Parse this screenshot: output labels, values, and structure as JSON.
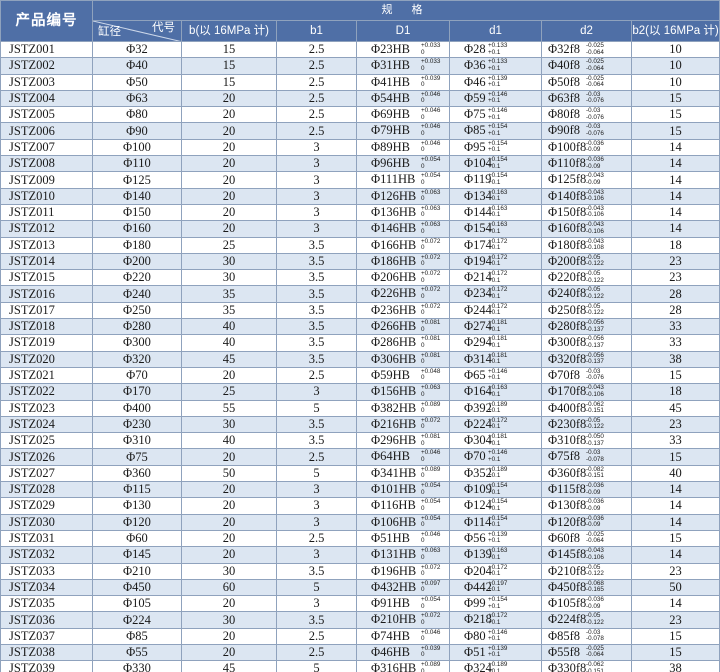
{
  "header": {
    "product_no": "产品编号",
    "specs": "规  格",
    "bore": "缸径",
    "code": "代号",
    "b": "b(以 16MPa 计)",
    "b1": "b1",
    "D1": "D1",
    "d1": "d1",
    "d2": "d2",
    "b2": "b2(以 16MPa 计)"
  },
  "rows": [
    {
      "model": "JSTZ001",
      "bore": "Φ32",
      "b": "15",
      "b1": "2.5",
      "D1": "Φ23HB",
      "D1_up": "+0.033",
      "D1_lo": "0",
      "d1": "Φ28",
      "d1_up": "+0.133",
      "d1_lo": "+0.1",
      "d2": "Φ32f8",
      "d2_up": "-0.025",
      "d2_lo": "-0.064",
      "b2": "10"
    },
    {
      "model": "JSTZ002",
      "bore": "Φ40",
      "b": "15",
      "b1": "2.5",
      "D1": "Φ31HB",
      "D1_up": "+0.033",
      "D1_lo": "0",
      "d1": "Φ36",
      "d1_up": "+0.133",
      "d1_lo": "+0.1",
      "d2": "Φ40f8",
      "d2_up": "-0.025",
      "d2_lo": "-0.064",
      "b2": "10"
    },
    {
      "model": "JSTZ003",
      "bore": "Φ50",
      "b": "15",
      "b1": "2.5",
      "D1": "Φ41HB",
      "D1_up": "+0.039",
      "D1_lo": "0",
      "d1": "Φ46",
      "d1_up": "+0.139",
      "d1_lo": "+0.1",
      "d2": "Φ50f8",
      "d2_up": "-0.025",
      "d2_lo": "-0.064",
      "b2": "10"
    },
    {
      "model": "JSTZ004",
      "bore": "Φ63",
      "b": "20",
      "b1": "2.5",
      "D1": "Φ54HB",
      "D1_up": "+0.046",
      "D1_lo": "0",
      "d1": "Φ59",
      "d1_up": "+0.146",
      "d1_lo": "+0.1",
      "d2": "Φ63f8",
      "d2_up": "-0.03",
      "d2_lo": "-0.076",
      "b2": "15"
    },
    {
      "model": "JSTZ005",
      "bore": "Φ80",
      "b": "20",
      "b1": "2.5",
      "D1": "Φ69HB",
      "D1_up": "+0.046",
      "D1_lo": "0",
      "d1": "Φ75",
      "d1_up": "+0.146",
      "d1_lo": "+0.1",
      "d2": "Φ80f8",
      "d2_up": "-0.03",
      "d2_lo": "-0.076",
      "b2": "15"
    },
    {
      "model": "JSTZ006",
      "bore": "Φ90",
      "b": "20",
      "b1": "2.5",
      "D1": "Φ79HB",
      "D1_up": "+0.046",
      "D1_lo": "0",
      "d1": "Φ85",
      "d1_up": "+0.154",
      "d1_lo": "+0.1",
      "d2": "Φ90f8",
      "d2_up": "-0.03",
      "d2_lo": "-0.076",
      "b2": "15"
    },
    {
      "model": "JSTZ007",
      "bore": "Φ100",
      "b": "20",
      "b1": "3",
      "D1": "Φ89HB",
      "D1_up": "+0.046",
      "D1_lo": "0",
      "d1": "Φ95",
      "d1_up": "+0.154",
      "d1_lo": "+0.1",
      "d2": "Φ100f8",
      "d2_up": "-0.036",
      "d2_lo": "-0.09",
      "b2": "14"
    },
    {
      "model": "JSTZ008",
      "bore": "Φ110",
      "b": "20",
      "b1": "3",
      "D1": "Φ96HB",
      "D1_up": "+0.054",
      "D1_lo": "0",
      "d1": "Φ104",
      "d1_up": "+0.154",
      "d1_lo": "+0.1",
      "d2": "Φ110f8",
      "d2_up": "-0.036",
      "d2_lo": "-0.09",
      "b2": "14"
    },
    {
      "model": "JSTZ009",
      "bore": "Φ125",
      "b": "20",
      "b1": "3",
      "D1": "Φ111HB",
      "D1_up": "+0.054",
      "D1_lo": "0",
      "d1": "Φ119",
      "d1_up": "+0.154",
      "d1_lo": "+0.1",
      "d2": "Φ125f8",
      "d2_up": "-0.043",
      "d2_lo": "-0.09",
      "b2": "14"
    },
    {
      "model": "JSTZ010",
      "bore": "Φ140",
      "b": "20",
      "b1": "3",
      "D1": "Φ126HB",
      "D1_up": "+0.063",
      "D1_lo": "0",
      "d1": "Φ134",
      "d1_up": "+0.163",
      "d1_lo": "+0.1",
      "d2": "Φ140f8",
      "d2_up": "-0.043",
      "d2_lo": "-0.106",
      "b2": "14"
    },
    {
      "model": "JSTZ011",
      "bore": "Φ150",
      "b": "20",
      "b1": "3",
      "D1": "Φ136HB",
      "D1_up": "+0.063",
      "D1_lo": "0",
      "d1": "Φ144",
      "d1_up": "+0.163",
      "d1_lo": "+0.1",
      "d2": "Φ150f8",
      "d2_up": "-0.043",
      "d2_lo": "-0.106",
      "b2": "14"
    },
    {
      "model": "JSTZ012",
      "bore": "Φ160",
      "b": "20",
      "b1": "3",
      "D1": "Φ146HB",
      "D1_up": "+0.063",
      "D1_lo": "0",
      "d1": "Φ154",
      "d1_up": "+0.163",
      "d1_lo": "+0.1",
      "d2": "Φ160f8",
      "d2_up": "-0.043",
      "d2_lo": "-0.106",
      "b2": "14"
    },
    {
      "model": "JSTZ013",
      "bore": "Φ180",
      "b": "25",
      "b1": "3.5",
      "D1": "Φ166HB",
      "D1_up": "+0.072",
      "D1_lo": "0",
      "d1": "Φ174",
      "d1_up": "+0.172",
      "d1_lo": "+0.1",
      "d2": "Φ180f8",
      "d2_up": "-0.043",
      "d2_lo": "-0.108",
      "b2": "18"
    },
    {
      "model": "JSTZ014",
      "bore": "Φ200",
      "b": "30",
      "b1": "3.5",
      "D1": "Φ186HB",
      "D1_up": "+0.072",
      "D1_lo": "0",
      "d1": "Φ194",
      "d1_up": "+0.172",
      "d1_lo": "+0.1",
      "d2": "Φ200f8",
      "d2_up": "-0.05",
      "d2_lo": "-0.122",
      "b2": "23"
    },
    {
      "model": "JSTZ015",
      "bore": "Φ220",
      "b": "30",
      "b1": "3.5",
      "D1": "Φ206HB",
      "D1_up": "+0.072",
      "D1_lo": "0",
      "d1": "Φ214",
      "d1_up": "+0.172",
      "d1_lo": "+0.1",
      "d2": "Φ220f8",
      "d2_up": "-0.05",
      "d2_lo": "-0.122",
      "b2": "23"
    },
    {
      "model": "JSTZ016",
      "bore": "Φ240",
      "b": "35",
      "b1": "3.5",
      "D1": "Φ226HB",
      "D1_up": "+0.072",
      "D1_lo": "0",
      "d1": "Φ234",
      "d1_up": "+0.172",
      "d1_lo": "+0.1",
      "d2": "Φ240f8",
      "d2_up": "-0.05",
      "d2_lo": "-0.122",
      "b2": "28"
    },
    {
      "model": "JSTZ017",
      "bore": "Φ250",
      "b": "35",
      "b1": "3.5",
      "D1": "Φ236HB",
      "D1_up": "+0.072",
      "D1_lo": "0",
      "d1": "Φ244",
      "d1_up": "+0.172",
      "d1_lo": "+0.1",
      "d2": "Φ250f8",
      "d2_up": "-0.05",
      "d2_lo": "-0.122",
      "b2": "28"
    },
    {
      "model": "JSTZ018",
      "bore": "Φ280",
      "b": "40",
      "b1": "3.5",
      "D1": "Φ266HB",
      "D1_up": "+0.081",
      "D1_lo": "0",
      "d1": "Φ274",
      "d1_up": "+0.181",
      "d1_lo": "+0.1",
      "d2": "Φ280f8",
      "d2_up": "-0.056",
      "d2_lo": "-0.137",
      "b2": "33"
    },
    {
      "model": "JSTZ019",
      "bore": "Φ300",
      "b": "40",
      "b1": "3.5",
      "D1": "Φ286HB",
      "D1_up": "+0.081",
      "D1_lo": "0",
      "d1": "Φ294",
      "d1_up": "+0.181",
      "d1_lo": "+0.1",
      "d2": "Φ300f8",
      "d2_up": "-0.056",
      "d2_lo": "-0.137",
      "b2": "33"
    },
    {
      "model": "JSTZ020",
      "bore": "Φ320",
      "b": "45",
      "b1": "3.5",
      "D1": "Φ306HB",
      "D1_up": "+0.081",
      "D1_lo": "0",
      "d1": "Φ314",
      "d1_up": "+0.181",
      "d1_lo": "+0.1",
      "d2": "Φ320f8",
      "d2_up": "-0.056",
      "d2_lo": "-0.137",
      "b2": "38"
    },
    {
      "model": "JSTZ021",
      "bore": "Φ70",
      "b": "20",
      "b1": "2.5",
      "D1": "Φ59HB",
      "D1_up": "+0.048",
      "D1_lo": "0",
      "d1": "Φ65",
      "d1_up": "+0.146",
      "d1_lo": "+0.1",
      "d2": "Φ70f8",
      "d2_up": "-0.03",
      "d2_lo": "-0.076",
      "b2": "15"
    },
    {
      "model": "JSTZ022",
      "bore": "Φ170",
      "b": "25",
      "b1": "3",
      "D1": "Φ156HB",
      "D1_up": "+0.063",
      "D1_lo": "0",
      "d1": "Φ164",
      "d1_up": "+0.163",
      "d1_lo": "+0.1",
      "d2": "Φ170f8",
      "d2_up": "-0.043",
      "d2_lo": "-0.106",
      "b2": "18"
    },
    {
      "model": "JSTZ023",
      "bore": "Φ400",
      "b": "55",
      "b1": "5",
      "D1": "Φ382HB",
      "D1_up": "+0.089",
      "D1_lo": "0",
      "d1": "Φ392",
      "d1_up": "+0.189",
      "d1_lo": "+0.1",
      "d2": "Φ400f8",
      "d2_up": "-0.062",
      "d2_lo": "-0.151",
      "b2": "45"
    },
    {
      "model": "JSTZ024",
      "bore": "Φ230",
      "b": "30",
      "b1": "3.5",
      "D1": "Φ216HB",
      "D1_up": "+0.072",
      "D1_lo": "0",
      "d1": "Φ224",
      "d1_up": "+0.172",
      "d1_lo": "+0.1",
      "d2": "Φ230f8",
      "d2_up": "-0.05",
      "d2_lo": "-0.122",
      "b2": "23"
    },
    {
      "model": "JSTZ025",
      "bore": "Φ310",
      "b": "40",
      "b1": "3.5",
      "D1": "Φ296HB",
      "D1_up": "+0.081",
      "D1_lo": "0",
      "d1": "Φ304",
      "d1_up": "+0.181",
      "d1_lo": "+0.1",
      "d2": "Φ310f8",
      "d2_up": "-0.050",
      "d2_lo": "-0.137",
      "b2": "33"
    },
    {
      "model": "JSTZ026",
      "bore": "Φ75",
      "b": "20",
      "b1": "2.5",
      "D1": "Φ64HB",
      "D1_up": "+0.046",
      "D1_lo": "0",
      "d1": "Φ70",
      "d1_up": "+0.146",
      "d1_lo": "+0.1",
      "d2": "Φ75f8",
      "d2_up": "-0.03",
      "d2_lo": "-0.078",
      "b2": "15"
    },
    {
      "model": "JSTZ027",
      "bore": "Φ360",
      "b": "50",
      "b1": "5",
      "D1": "Φ341HB",
      "D1_up": "+0.089",
      "D1_lo": "0",
      "d1": "Φ352",
      "d1_up": "+0.189",
      "d1_lo": "+0.1",
      "d2": "Φ360f8",
      "d2_up": "-0.082",
      "d2_lo": "-0.151",
      "b2": "40"
    },
    {
      "model": "JSTZ028",
      "bore": "Φ115",
      "b": "20",
      "b1": "3",
      "D1": "Φ101HB",
      "D1_up": "+0.054",
      "D1_lo": "0",
      "d1": "Φ109",
      "d1_up": "+0.154",
      "d1_lo": "+0.1",
      "d2": "Φ115f8",
      "d2_up": "-0.036",
      "d2_lo": "-0.09",
      "b2": "14"
    },
    {
      "model": "JSTZ029",
      "bore": "Φ130",
      "b": "20",
      "b1": "3",
      "D1": "Φ116HB",
      "D1_up": "+0.054",
      "D1_lo": "0",
      "d1": "Φ124",
      "d1_up": "+0.154",
      "d1_lo": "+0.1",
      "d2": "Φ130f8",
      "d2_up": "-0.036",
      "d2_lo": "-0.09",
      "b2": "14"
    },
    {
      "model": "JSTZ030",
      "bore": "Φ120",
      "b": "20",
      "b1": "3",
      "D1": "Φ106HB",
      "D1_up": "+0.054",
      "D1_lo": "0",
      "d1": "Φ114",
      "d1_up": "+0.154",
      "d1_lo": "+0.1",
      "d2": "Φ120f8",
      "d2_up": "-0.036",
      "d2_lo": "-0.09",
      "b2": "14"
    },
    {
      "model": "JSTZ031",
      "bore": "Φ60",
      "b": "20",
      "b1": "2.5",
      "D1": "Φ51HB",
      "D1_up": "+0.046",
      "D1_lo": "0",
      "d1": "Φ56",
      "d1_up": "+0.139",
      "d1_lo": "+0.1",
      "d2": "Φ60f8",
      "d2_up": "-0.025",
      "d2_lo": "-0.064",
      "b2": "15"
    },
    {
      "model": "JSTZ032",
      "bore": "Φ145",
      "b": "20",
      "b1": "3",
      "D1": "Φ131HB",
      "D1_up": "+0.063",
      "D1_lo": "0",
      "d1": "Φ139",
      "d1_up": "+0.163",
      "d1_lo": "+0.1",
      "d2": "Φ145f8",
      "d2_up": "-0.043",
      "d2_lo": "-0.106",
      "b2": "14"
    },
    {
      "model": "JSTZ033",
      "bore": "Φ210",
      "b": "30",
      "b1": "3.5",
      "D1": "Φ196HB",
      "D1_up": "+0.072",
      "D1_lo": "0",
      "d1": "Φ204",
      "d1_up": "+0.172",
      "d1_lo": "+0.1",
      "d2": "Φ210f8",
      "d2_up": "-0.05",
      "d2_lo": "-0.122",
      "b2": "23"
    },
    {
      "model": "JSTZ034",
      "bore": "Φ450",
      "b": "60",
      "b1": "5",
      "D1": "Φ432HB",
      "D1_up": "+0.097",
      "D1_lo": "0",
      "d1": "Φ442",
      "d1_up": "+0.197",
      "d1_lo": "+0.1",
      "d2": "Φ450f8",
      "d2_up": "-0.068",
      "d2_lo": "-0.165",
      "b2": "50"
    },
    {
      "model": "JSTZ035",
      "bore": "Φ105",
      "b": "20",
      "b1": "3",
      "D1": "Φ91HB",
      "D1_up": "+0.054",
      "D1_lo": "0",
      "d1": "Φ99",
      "d1_up": "+0.154",
      "d1_lo": "+0.1",
      "d2": "Φ105f8",
      "d2_up": "-0.036",
      "d2_lo": "-0.09",
      "b2": "14"
    },
    {
      "model": "JSTZ036",
      "bore": "Φ224",
      "b": "30",
      "b1": "3.5",
      "D1": "Φ210HB",
      "D1_up": "+0.072",
      "D1_lo": "0",
      "d1": "Φ218",
      "d1_up": "+0.172",
      "d1_lo": "+0.1",
      "d2": "Φ224f8",
      "d2_up": "-0.05",
      "d2_lo": "-0.122",
      "b2": "23"
    },
    {
      "model": "JSTZ037",
      "bore": "Φ85",
      "b": "20",
      "b1": "2.5",
      "D1": "Φ74HB",
      "D1_up": "+0.046",
      "D1_lo": "0",
      "d1": "Φ80",
      "d1_up": "+0.146",
      "d1_lo": "+0.1",
      "d2": "Φ85f8",
      "d2_up": "-0.03",
      "d2_lo": "-0.078",
      "b2": "15"
    },
    {
      "model": "JSTZ038",
      "bore": "Φ55",
      "b": "20",
      "b1": "2.5",
      "D1": "Φ46HB",
      "D1_up": "+0.039",
      "D1_lo": "0",
      "d1": "Φ51",
      "d1_up": "+0.139",
      "d1_lo": "+0.1",
      "d2": "Φ55f8",
      "d2_up": "-0.025",
      "d2_lo": "-0.064",
      "b2": "15"
    },
    {
      "model": "JSTZ039",
      "bore": "Φ330",
      "b": "45",
      "b1": "5",
      "D1": "Φ316HB",
      "D1_up": "+0.089",
      "D1_lo": "0",
      "d1": "Φ324",
      "d1_up": "+0.189",
      "d1_lo": "+0.1",
      "d2": "Φ330f8",
      "d2_up": "-0.062",
      "d2_lo": "-0.151",
      "b2": "38"
    }
  ]
}
